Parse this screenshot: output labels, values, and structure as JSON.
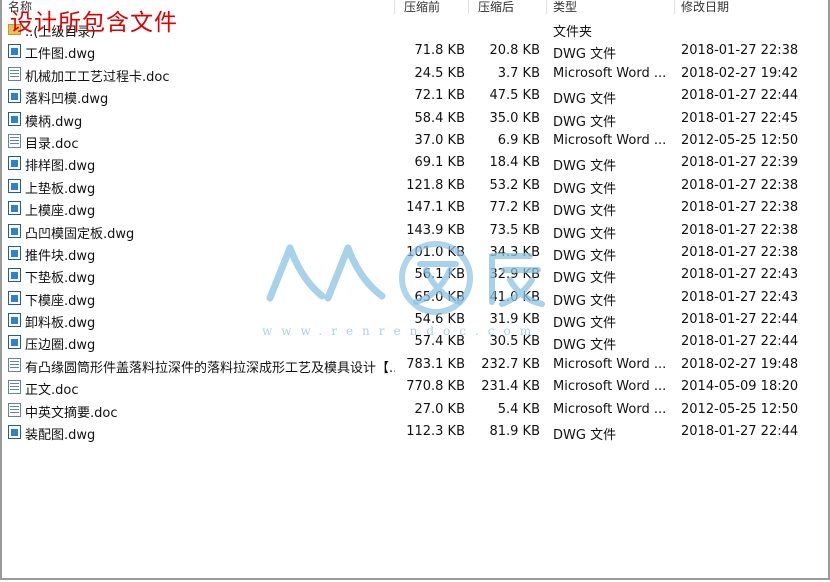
{
  "overlay_title": "设计所包含文件",
  "columns": {
    "name": "名称",
    "packed": "压缩前",
    "compressed": "压缩后",
    "type": "类型",
    "modified": "修改日期"
  },
  "watermark": {
    "logo_text": "人人文库",
    "url_text": "www.renrendoc.com"
  },
  "files": [
    {
      "icon": "folder-icon",
      "name": "..(上级目录)",
      "before": "",
      "after": "",
      "type": "文件夹",
      "date": ""
    },
    {
      "icon": "dwg-file-icon",
      "name": "工件图.dwg",
      "before": "71.8 KB",
      "after": "20.8 KB",
      "type": "DWG 文件",
      "date": "2018-01-27 22:38"
    },
    {
      "icon": "word-file-icon",
      "name": "机械加工工艺过程卡.doc",
      "before": "24.5 KB",
      "after": "3.7 KB",
      "type": "Microsoft Word ...",
      "date": "2018-02-27 19:42"
    },
    {
      "icon": "dwg-file-icon",
      "name": "落料凹模.dwg",
      "before": "72.1 KB",
      "after": "47.5 KB",
      "type": "DWG 文件",
      "date": "2018-01-27 22:44"
    },
    {
      "icon": "dwg-file-icon",
      "name": "模柄.dwg",
      "before": "58.4 KB",
      "after": "35.0 KB",
      "type": "DWG 文件",
      "date": "2018-01-27 22:45"
    },
    {
      "icon": "word-file-icon",
      "name": "目录.doc",
      "before": "37.0 KB",
      "after": "6.9 KB",
      "type": "Microsoft Word ...",
      "date": "2012-05-25 12:50"
    },
    {
      "icon": "dwg-file-icon",
      "name": "排样图.dwg",
      "before": "69.1 KB",
      "after": "18.4 KB",
      "type": "DWG 文件",
      "date": "2018-01-27 22:39"
    },
    {
      "icon": "dwg-file-icon",
      "name": "上垫板.dwg",
      "before": "121.8 KB",
      "after": "53.2 KB",
      "type": "DWG 文件",
      "date": "2018-01-27 22:38"
    },
    {
      "icon": "dwg-file-icon",
      "name": "上模座.dwg",
      "before": "147.1 KB",
      "after": "77.2 KB",
      "type": "DWG 文件",
      "date": "2018-01-27 22:38"
    },
    {
      "icon": "dwg-file-icon",
      "name": "凸凹模固定板.dwg",
      "before": "143.9 KB",
      "after": "73.5 KB",
      "type": "DWG 文件",
      "date": "2018-01-27 22:38"
    },
    {
      "icon": "dwg-file-icon",
      "name": "推件块.dwg",
      "before": "101.0 KB",
      "after": "34.3 KB",
      "type": "DWG 文件",
      "date": "2018-01-27 22:38"
    },
    {
      "icon": "dwg-file-icon",
      "name": "下垫板.dwg",
      "before": "56.1 KB",
      "after": "32.9 KB",
      "type": "DWG 文件",
      "date": "2018-01-27 22:43"
    },
    {
      "icon": "dwg-file-icon",
      "name": "下模座.dwg",
      "before": "65.0 KB",
      "after": "41.0 KB",
      "type": "DWG 文件",
      "date": "2018-01-27 22:43"
    },
    {
      "icon": "dwg-file-icon",
      "name": "卸料板.dwg",
      "before": "54.6 KB",
      "after": "31.9 KB",
      "type": "DWG 文件",
      "date": "2018-01-27 22:44"
    },
    {
      "icon": "dwg-file-icon",
      "name": "压边圈.dwg",
      "before": "57.4 KB",
      "after": "30.5 KB",
      "type": "DWG 文件",
      "date": "2018-01-27 22:44"
    },
    {
      "icon": "word-file-icon",
      "name": "有凸缘圆筒形件盖落料拉深件的落料拉深成形工艺及模具设计【...",
      "before": "783.1 KB",
      "after": "232.7 KB",
      "type": "Microsoft Word ...",
      "date": "2018-02-27 19:48"
    },
    {
      "icon": "word-file-icon",
      "name": "正文.doc",
      "before": "770.8 KB",
      "after": "231.4 KB",
      "type": "Microsoft Word ...",
      "date": "2014-05-09 18:20"
    },
    {
      "icon": "word-file-icon",
      "name": "中英文摘要.doc",
      "before": "27.0 KB",
      "after": "5.4 KB",
      "type": "Microsoft Word ...",
      "date": "2012-05-25 12:50"
    },
    {
      "icon": "dwg-file-icon",
      "name": "装配图.dwg",
      "before": "112.3 KB",
      "after": "81.9 KB",
      "type": "DWG 文件",
      "date": "2018-01-27 22:44"
    }
  ]
}
